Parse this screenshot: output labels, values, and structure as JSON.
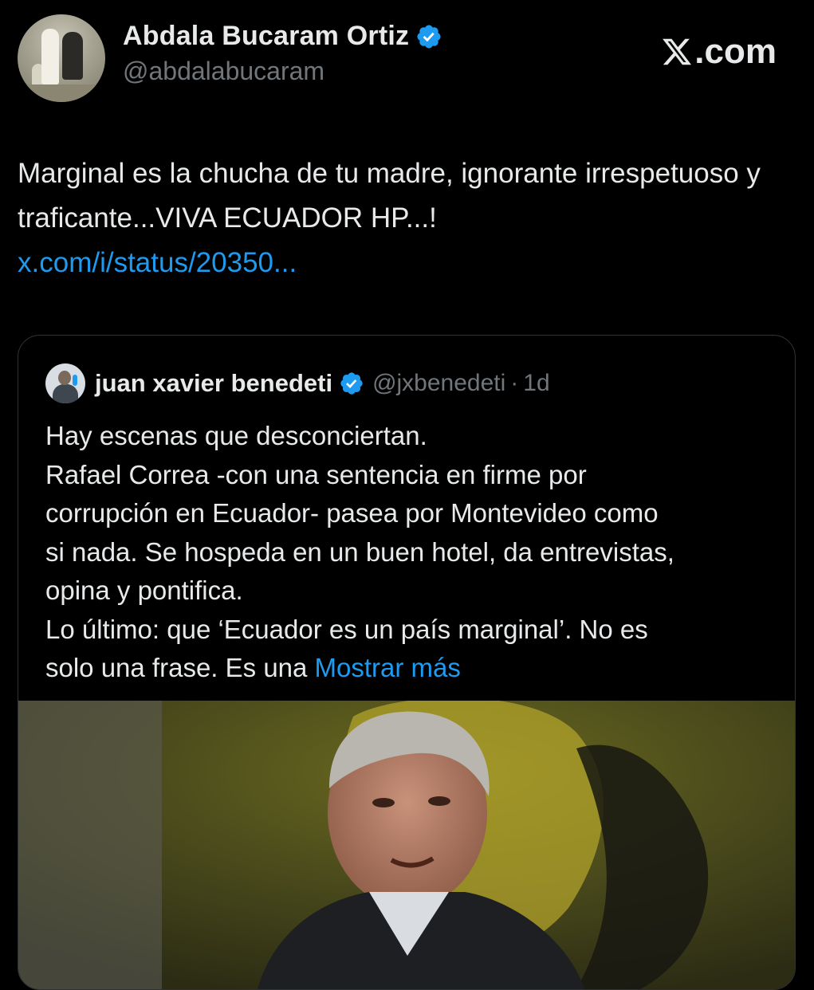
{
  "tweet": {
    "author": {
      "name": "Abdala Bucaram Ortiz",
      "handle": "@abdalabucaram"
    },
    "site_label": ".com",
    "text": "Marginal es la chucha de tu madre, ignorante irrespetuoso y traficante...VIVA ECUADOR HP...!",
    "link": "x.com/i/status/20350...",
    "icons": [
      "avatar-photo",
      "verified-badge-icon",
      "x-logo-icon"
    ],
    "colors": {
      "background": "#000000",
      "text": "#e7e9ea",
      "secondary": "#71767b",
      "accent": "#1d9bf0",
      "border": "#2f3336"
    }
  },
  "quote": {
    "author": {
      "name": "juan xavier benedeti",
      "handle": "@jxbenedeti",
      "separator": "·",
      "time": "1d"
    },
    "lines": [
      "Hay escenas que desconciertan.",
      "Rafael Correa -con una sentencia en firme por",
      "corrupción en Ecuador- pasea por Montevideo como",
      "si nada. Se hospeda en un buen hotel, da entrevistas,",
      "opina y pontifica.",
      "Lo último: que ‘Ecuador es un país marginal’. No es",
      "solo una frase. Es una"
    ],
    "show_more": "Mostrar más",
    "media": {
      "type": "video-frame",
      "description_icon": "video-thumbnail"
    }
  }
}
